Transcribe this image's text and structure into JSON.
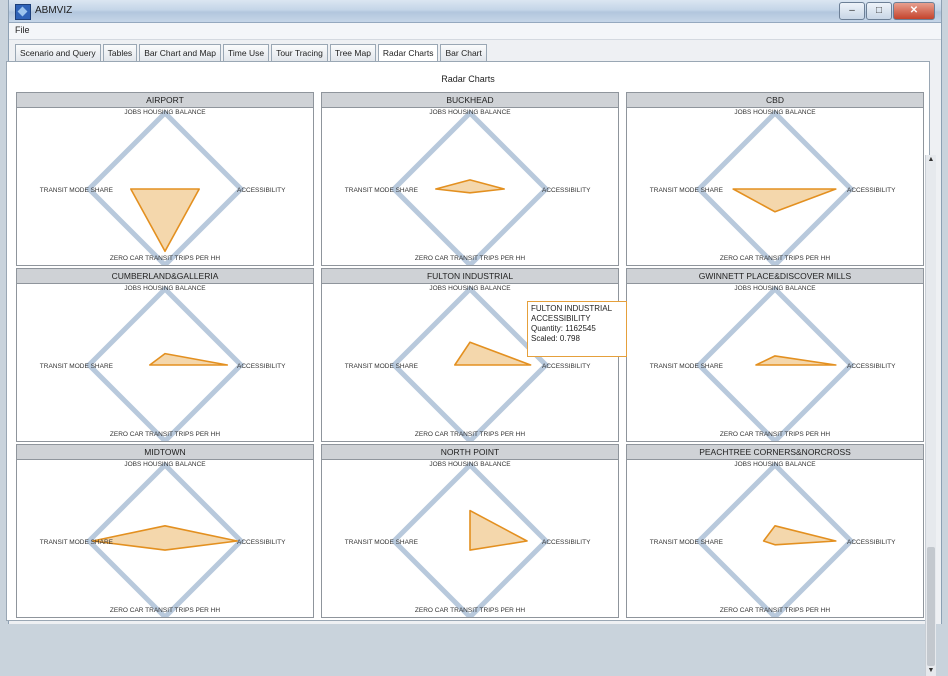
{
  "window": {
    "title": "ABMVIZ",
    "buttons": {
      "minimize": "–",
      "maximize": "□",
      "close": "✕"
    }
  },
  "menu": {
    "file": "File"
  },
  "tabs": [
    {
      "label": "Scenario and Query",
      "active": false
    },
    {
      "label": "Tables",
      "active": false
    },
    {
      "label": "Bar Chart and Map",
      "active": false
    },
    {
      "label": "Time Use",
      "active": false
    },
    {
      "label": "Tour Tracing",
      "active": false
    },
    {
      "label": "Tree Map",
      "active": false
    },
    {
      "label": "Radar Charts",
      "active": true
    },
    {
      "label": "Bar Chart",
      "active": false
    }
  ],
  "content_title": "Radar Charts",
  "scrollbar": {
    "up": "▲",
    "down": "▼"
  },
  "colors": {
    "diamond": "#b8c9dc",
    "fill": "#f3d3a3",
    "stroke": "#e39020",
    "header": "#cfd2d6"
  },
  "axes": {
    "top": "JOBS HOUSING BALANCE",
    "right": "ACCESSIBILITY",
    "bottom": "ZERO CAR TRANSIT TRIPS PER HH",
    "left": "TRANSIT MODE SHARE"
  },
  "chart_data": {
    "type": "radar",
    "axes": [
      "JOBS HOUSING BALANCE",
      "ACCESSIBILITY",
      "ZERO CAR TRANSIT TRIPS PER HH",
      "TRANSIT MODE SHARE"
    ],
    "scale": [
      0,
      1
    ],
    "charts": [
      {
        "title": "AIRPORT",
        "values": [
          0.0,
          0.45,
          0.82,
          0.45
        ]
      },
      {
        "title": "BUCKHEAD",
        "values": [
          0.12,
          0.45,
          0.05,
          0.45
        ]
      },
      {
        "title": "CBD",
        "values": [
          0.0,
          0.8,
          0.3,
          0.55
        ]
      },
      {
        "title": "CUMBERLAND&GALLERIA",
        "values": [
          0.15,
          0.82,
          0.0,
          0.2
        ]
      },
      {
        "title": "FULTON INDUSTRIAL",
        "values": [
          0.3,
          0.798,
          0.0,
          0.2
        ]
      },
      {
        "title": "GWINNETT PLACE&DISCOVER MILLS",
        "values": [
          0.12,
          0.8,
          0.0,
          0.25
        ]
      },
      {
        "title": "MIDTOWN",
        "values": [
          0.2,
          0.95,
          0.12,
          0.95
        ]
      },
      {
        "title": "NORTH POINT",
        "values": [
          0.4,
          0.75,
          0.12,
          0.0
        ]
      },
      {
        "title": "PEACHTREE CORNERS&NORCROSS",
        "values": [
          0.2,
          0.8,
          0.05,
          0.15
        ]
      }
    ]
  },
  "tooltip": {
    "area": "FULTON INDUSTRIAL",
    "axis": "ACCESSIBILITY",
    "quantity": "Quantity: 1162545",
    "scaled": "Scaled: 0.798"
  }
}
